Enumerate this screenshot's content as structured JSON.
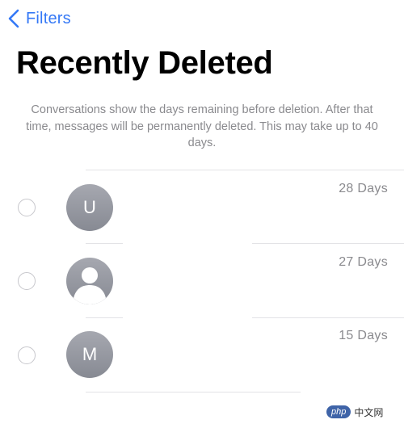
{
  "nav": {
    "back_label": "Filters"
  },
  "page": {
    "title": "Recently Deleted",
    "description": "Conversations show the days remaining before deletion. After that time, messages will be permanently deleted. This may take up to 40 days."
  },
  "conversations": [
    {
      "avatar_type": "initial",
      "initial": "U",
      "days_remaining": "28 Days"
    },
    {
      "avatar_type": "person-silhouette-icon",
      "initial": "",
      "days_remaining": "27 Days"
    },
    {
      "avatar_type": "initial",
      "initial": "M",
      "days_remaining": "15 Days"
    }
  ],
  "watermark": {
    "badge": "php",
    "text": "中文网"
  },
  "colors": {
    "accent": "#3478f6",
    "secondary_text": "#8a8a8e",
    "avatar_gray": "#8e9099",
    "radio_border": "#c7c7cc",
    "divider": "#e3e3e6"
  }
}
